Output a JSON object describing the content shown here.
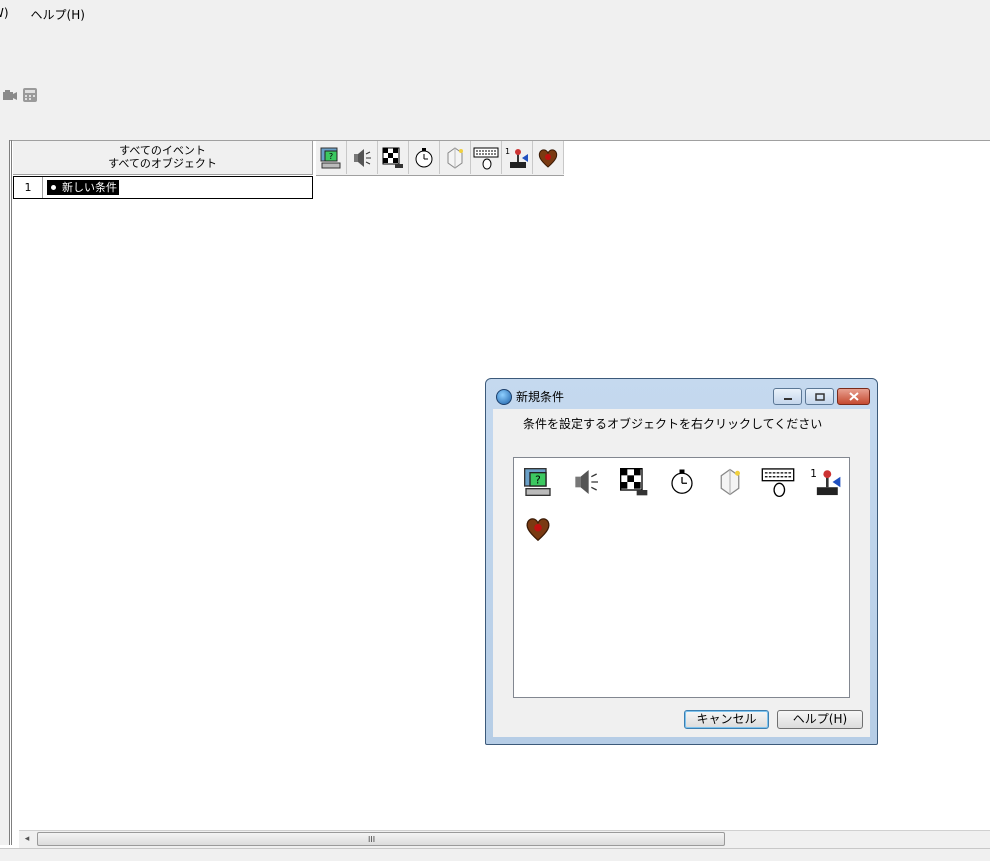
{
  "menubar": {
    "items": [
      "W)",
      "ヘルプ(H)"
    ]
  },
  "toolbar": {
    "icons": [
      "camera-icon",
      "grid-panel-icon"
    ]
  },
  "editor": {
    "header": {
      "line1": "すべてのイベント",
      "line2": "すべてのオブジェクト"
    },
    "object_icons": [
      "computer-question-icon",
      "speaker-icon",
      "checkerboard-icon",
      "stopwatch-icon",
      "crystal-icon",
      "keyboard-mouse-icon",
      "joystick-icon",
      "heart-icon"
    ],
    "rows": [
      {
        "number": "1",
        "label": "新しい条件"
      }
    ]
  },
  "scrollbar": {
    "grip": "III"
  },
  "dialog": {
    "title": "新規条件",
    "instruction": "条件を設定するオブジェクトを右クリックしてください",
    "icons": [
      "computer-question-icon",
      "speaker-icon",
      "checkerboard-icon",
      "stopwatch-icon",
      "crystal-icon",
      "keyboard-mouse-icon",
      "joystick-icon",
      "heart-icon"
    ],
    "cancel_label": "キャンセル",
    "help_label": "ヘルプ(H)"
  }
}
